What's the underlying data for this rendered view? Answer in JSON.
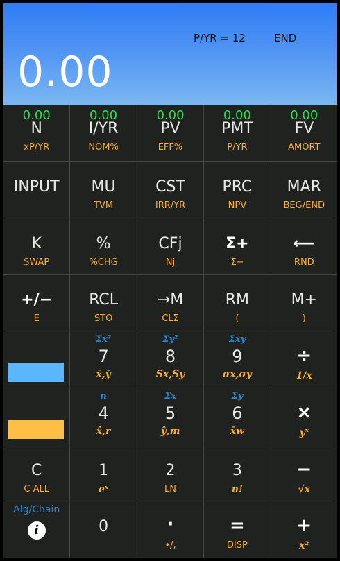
{
  "display": {
    "pyr": "P/YR = 12",
    "mode": "END",
    "value": "0.00"
  },
  "colors": {
    "display_top": "#2f7df6",
    "display_bottom": "#7ab7f2",
    "key_bg": "#202220",
    "register_green": "#29e04a",
    "shift_orange": "#ffb033",
    "shift_blue": "#2a86d3",
    "swatch_blue": "#5ab7ff",
    "swatch_orange": "#ffbf46"
  },
  "tvm": [
    {
      "reg": "0.00",
      "main": "N",
      "sub": "xP/YR"
    },
    {
      "reg": "0.00",
      "main": "I/YR",
      "sub": "NOM%"
    },
    {
      "reg": "0.00",
      "main": "PV",
      "sub": "EFF%"
    },
    {
      "reg": "0.00",
      "main": "PMT",
      "sub": "P/YR"
    },
    {
      "reg": "0.00",
      "main": "FV",
      "sub": "AMORT"
    }
  ],
  "row2": [
    {
      "main": "INPUT",
      "sub": ""
    },
    {
      "main": "MU",
      "sub": "TVM"
    },
    {
      "main": "CST",
      "sub": "IRR/YR"
    },
    {
      "main": "PRC",
      "sub": "NPV"
    },
    {
      "main": "MAR",
      "sub": "BEG/END"
    }
  ],
  "row3": [
    {
      "main": "K",
      "sub": "SWAP"
    },
    {
      "main": "%",
      "sub": "%CHG"
    },
    {
      "main": "CFj",
      "sub": "Nj"
    },
    {
      "main": "Σ+",
      "sub": "Σ−"
    },
    {
      "main": "⟵",
      "sub": "RND"
    }
  ],
  "row4": [
    {
      "main": "+/−",
      "sub": "E"
    },
    {
      "main": "RCL",
      "sub": "STO"
    },
    {
      "main": "→M",
      "sub": "CLΣ"
    },
    {
      "main": "RM",
      "sub": "("
    },
    {
      "main": "M+",
      "sub": ")"
    }
  ],
  "row5": [
    {
      "top": "",
      "main": "",
      "sub": ""
    },
    {
      "top": "Σx²",
      "main": "7",
      "sub": "x̄,ȳ"
    },
    {
      "top": "Σy²",
      "main": "8",
      "sub": "Sx,Sy"
    },
    {
      "top": "Σxy",
      "main": "9",
      "sub": "σx,σy"
    },
    {
      "top": "",
      "main": "÷",
      "sub": "1/x"
    }
  ],
  "row6": [
    {
      "top": "",
      "main": "",
      "sub": ""
    },
    {
      "top": "n",
      "main": "4",
      "sub": "x̂,r"
    },
    {
      "top": "Σx",
      "main": "5",
      "sub": "ŷ,m"
    },
    {
      "top": "Σy",
      "main": "6",
      "sub": "x̄w"
    },
    {
      "top": "",
      "main": "×",
      "sub": "yˣ"
    }
  ],
  "row7": [
    {
      "main": "C",
      "sub": "C ALL"
    },
    {
      "main": "1",
      "sub": "eˣ"
    },
    {
      "main": "2",
      "sub": "LN"
    },
    {
      "main": "3",
      "sub": "n!"
    },
    {
      "main": "−",
      "sub": "√x"
    }
  ],
  "row8": [
    {
      "top": "Alg/Chain",
      "main": "i",
      "sub": ""
    },
    {
      "main": "0",
      "sub": ""
    },
    {
      "main": "·",
      "sub": "•/,"
    },
    {
      "main": "=",
      "sub": "DISP"
    },
    {
      "main": "+",
      "sub": "x²"
    }
  ]
}
